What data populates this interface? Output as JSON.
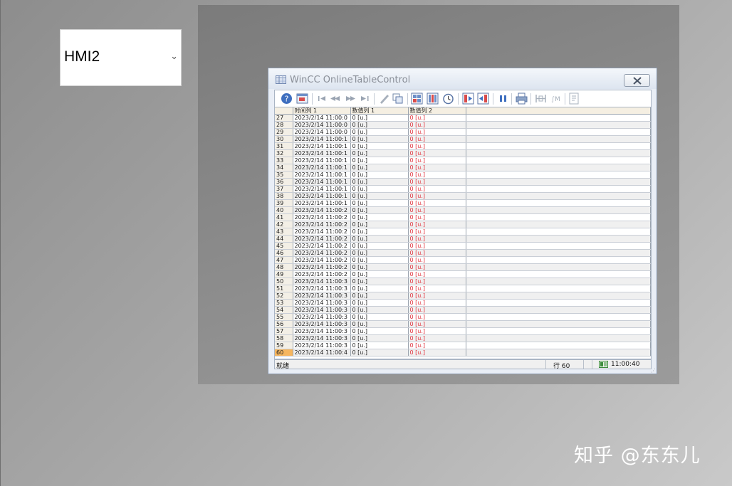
{
  "dropdown": {
    "selected": "HMI2",
    "arrow": "⌄"
  },
  "window": {
    "title": "WinCC OnlineTableControl",
    "close_icon": "close-icon",
    "title_icon": "table-icon"
  },
  "toolbar": {
    "icons": [
      "help-icon",
      "config-dialog-icon",
      "first-record-icon",
      "previous-record-icon",
      "next-record-icon",
      "last-record-icon",
      "edit-icon",
      "copy-rows-icon",
      "select-archive-tag-icon",
      "select-columns-icon",
      "select-time-range-icon",
      "previous-column-icon",
      "next-column-icon",
      "start-stop-icon",
      "print-icon",
      "define-statistics-area-icon",
      "calculate-statistics-icon",
      "export-data-icon"
    ]
  },
  "table": {
    "columns": [
      "",
      "时间列 1",
      "数值列 1",
      "数值列 2"
    ],
    "rows": [
      {
        "n": "27",
        "time": "2023/2/14 11:00:0",
        "v1": "0 [u.]",
        "v2": "0 [u.]"
      },
      {
        "n": "28",
        "time": "2023/2/14 11:00:0",
        "v1": "0 [u.]",
        "v2": "0 [u.]"
      },
      {
        "n": "29",
        "time": "2023/2/14 11:00:0",
        "v1": "0 [u.]",
        "v2": "0 [u.]"
      },
      {
        "n": "30",
        "time": "2023/2/14 11:00:1",
        "v1": "0 [u.]",
        "v2": "0 [u.]"
      },
      {
        "n": "31",
        "time": "2023/2/14 11:00:1",
        "v1": "0 [u.]",
        "v2": "0 [u.]"
      },
      {
        "n": "32",
        "time": "2023/2/14 11:00:1",
        "v1": "0 [u.]",
        "v2": "0 [u.]"
      },
      {
        "n": "33",
        "time": "2023/2/14 11:00:1",
        "v1": "0 [u.]",
        "v2": "0 [u.]"
      },
      {
        "n": "34",
        "time": "2023/2/14 11:00:1",
        "v1": "0 [u.]",
        "v2": "0 [u.]"
      },
      {
        "n": "35",
        "time": "2023/2/14 11:00:1",
        "v1": "0 [u.]",
        "v2": "0 [u.]"
      },
      {
        "n": "36",
        "time": "2023/2/14 11:00:1",
        "v1": "0 [u.]",
        "v2": "0 [u.]"
      },
      {
        "n": "37",
        "time": "2023/2/14 11:00:1",
        "v1": "0 [u.]",
        "v2": "0 [u.]"
      },
      {
        "n": "38",
        "time": "2023/2/14 11:00:1",
        "v1": "0 [u.]",
        "v2": "0 [u.]"
      },
      {
        "n": "39",
        "time": "2023/2/14 11:00:1",
        "v1": "0 [u.]",
        "v2": "0 [u.]"
      },
      {
        "n": "40",
        "time": "2023/2/14 11:00:2",
        "v1": "0 [u.]",
        "v2": "0 [u.]"
      },
      {
        "n": "41",
        "time": "2023/2/14 11:00:2",
        "v1": "0 [u.]",
        "v2": "0 [u.]"
      },
      {
        "n": "42",
        "time": "2023/2/14 11:00:2",
        "v1": "0 [u.]",
        "v2": "0 [u.]"
      },
      {
        "n": "43",
        "time": "2023/2/14 11:00:2",
        "v1": "0 [u.]",
        "v2": "0 [u.]"
      },
      {
        "n": "44",
        "time": "2023/2/14 11:00:2",
        "v1": "0 [u.]",
        "v2": "0 [u.]"
      },
      {
        "n": "45",
        "time": "2023/2/14 11:00:2",
        "v1": "0 [u.]",
        "v2": "0 [u.]"
      },
      {
        "n": "46",
        "time": "2023/2/14 11:00:2",
        "v1": "0 [u.]",
        "v2": "0 [u.]"
      },
      {
        "n": "47",
        "time": "2023/2/14 11:00:2",
        "v1": "0 [u.]",
        "v2": "0 [u.]"
      },
      {
        "n": "48",
        "time": "2023/2/14 11:00:2",
        "v1": "0 [u.]",
        "v2": "0 [u.]"
      },
      {
        "n": "49",
        "time": "2023/2/14 11:00:2",
        "v1": "0 [u.]",
        "v2": "0 [u.]"
      },
      {
        "n": "50",
        "time": "2023/2/14 11:00:3",
        "v1": "0 [u.]",
        "v2": "0 [u.]"
      },
      {
        "n": "51",
        "time": "2023/2/14 11:00:3",
        "v1": "0 [u.]",
        "v2": "0 [u.]"
      },
      {
        "n": "52",
        "time": "2023/2/14 11:00:3",
        "v1": "0 [u.]",
        "v2": "0 [u.]"
      },
      {
        "n": "53",
        "time": "2023/2/14 11:00:3",
        "v1": "0 [u.]",
        "v2": "0 [u.]"
      },
      {
        "n": "54",
        "time": "2023/2/14 11:00:3",
        "v1": "0 [u.]",
        "v2": "0 [u.]"
      },
      {
        "n": "55",
        "time": "2023/2/14 11:00:3",
        "v1": "0 [u.]",
        "v2": "0 [u.]"
      },
      {
        "n": "56",
        "time": "2023/2/14 11:00:3",
        "v1": "0 [u.]",
        "v2": "0 [u.]"
      },
      {
        "n": "57",
        "time": "2023/2/14 11:00:3",
        "v1": "0 [u.]",
        "v2": "0 [u.]"
      },
      {
        "n": "58",
        "time": "2023/2/14 11:00:3",
        "v1": "0 [u.]",
        "v2": "0 [u.]"
      },
      {
        "n": "59",
        "time": "2023/2/14 11:00:3",
        "v1": "0 [u.]",
        "v2": "0 [u.]"
      },
      {
        "n": "60",
        "time": "2023/2/14 11:00:4",
        "v1": "0 [u.]",
        "v2": "0 [u.]"
      }
    ],
    "active_row": "60"
  },
  "status": {
    "text": "就绪",
    "row": "行 60",
    "time": "11:00:40",
    "time_icon": "time-status-icon"
  },
  "watermark": "知乎 @东东儿",
  "colors": {
    "value2_text": "#e0303a",
    "active_row": "#f6b65f",
    "header_bg": "#f5efe2"
  }
}
